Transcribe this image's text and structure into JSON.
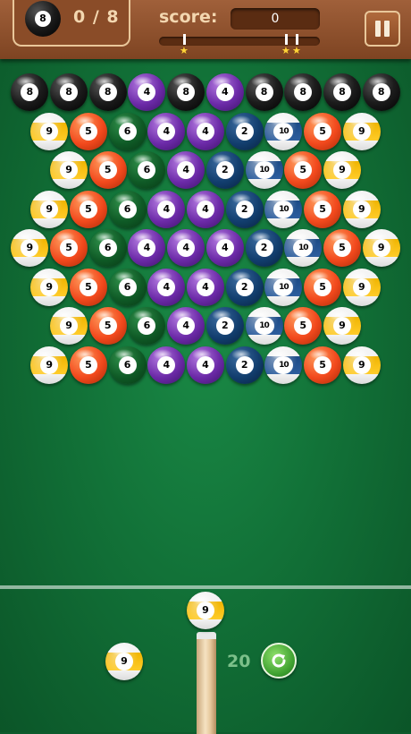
{
  "header": {
    "goal_ball_number": "8",
    "goal_counter": "0 / 8",
    "score_label": "score:",
    "score_value": "0",
    "progress_fraction": 0.0,
    "star_icon": "★"
  },
  "board": {
    "rows": [
      [
        "8",
        "8",
        "8",
        "4",
        "8",
        "4",
        "8",
        "8",
        "8",
        "8"
      ],
      [
        "9",
        "5",
        "6",
        "4",
        "4",
        "2",
        "10",
        "5",
        "9"
      ],
      [
        "9",
        "5",
        "6",
        "4",
        "2",
        "10",
        "5",
        "9"
      ],
      [
        "9",
        "5",
        "6",
        "4",
        "4",
        "2",
        "10",
        "5",
        "9"
      ],
      [
        "9",
        "5",
        "6",
        "4",
        "4",
        "4",
        "2",
        "10",
        "5",
        "9"
      ],
      [
        "9",
        "5",
        "6",
        "4",
        "4",
        "2",
        "10",
        "5",
        "9"
      ],
      [
        "9",
        "5",
        "6",
        "4",
        "2",
        "10",
        "5",
        "9"
      ],
      [
        "9",
        "5",
        "6",
        "4",
        "4",
        "2",
        "10",
        "5",
        "9"
      ]
    ]
  },
  "shooter": {
    "current_ball": "9",
    "next_ball": "9",
    "shots_left": "20"
  },
  "colors": {
    "felt": "#127238",
    "header_wood": "#8a4c28",
    "accent": "#f3d7b0"
  },
  "icons": {
    "pause": "pause-icon",
    "swap": "swap-arrow-icon"
  }
}
